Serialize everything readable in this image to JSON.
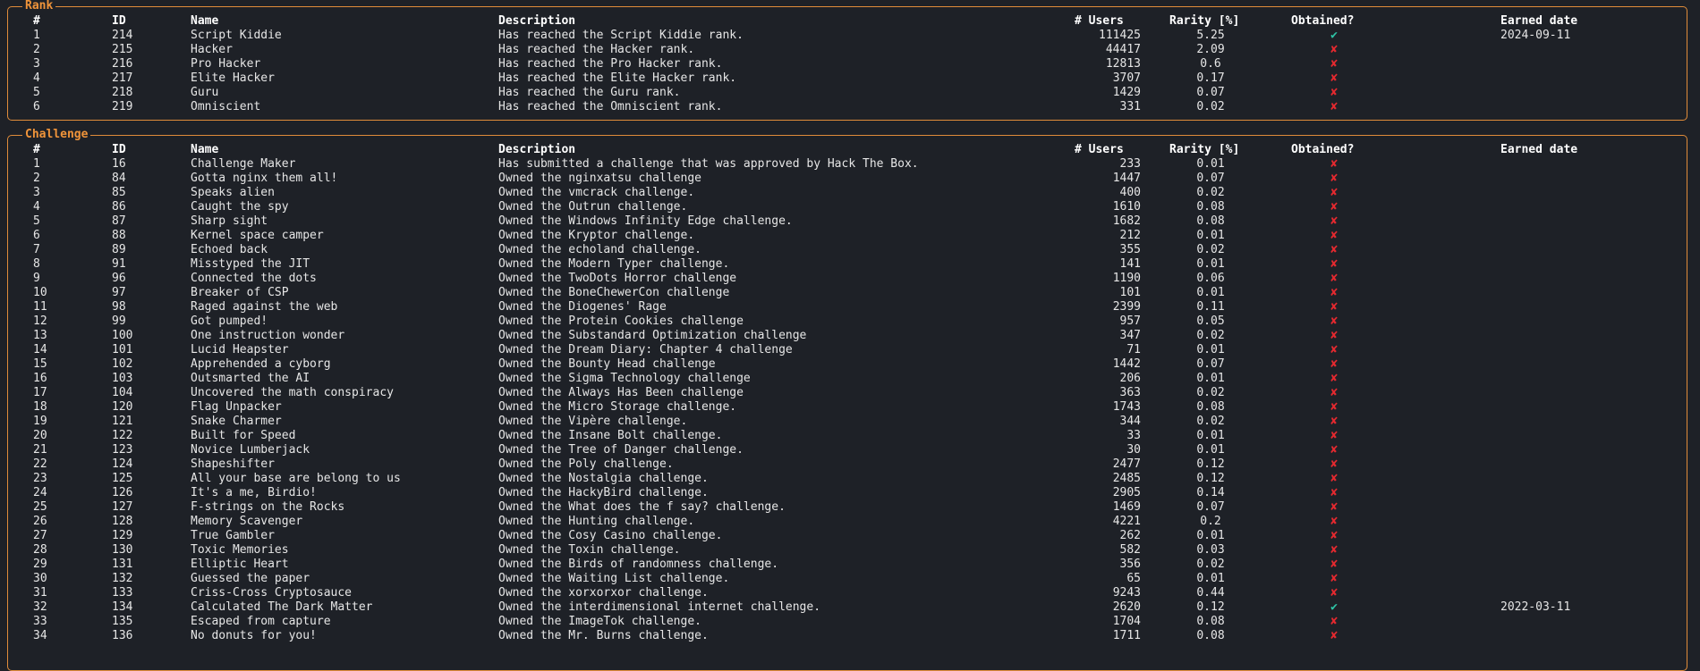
{
  "colors": {
    "border": "#e08c3a",
    "title": "#f0943a",
    "check": "#2ec4a6",
    "cross": "#e5292f",
    "background": "#1e2127"
  },
  "icons": {
    "obtained": "check-icon",
    "not_obtained": "cross-icon"
  },
  "headers": {
    "num": "#",
    "id": "ID",
    "name": "Name",
    "description": "Description",
    "users": "# Users",
    "rarity": "Rarity [%]",
    "obtained": "Obtained?",
    "earned": "Earned date"
  },
  "rank": {
    "title": "Rank",
    "rows": [
      {
        "num": "1",
        "id": "214",
        "name": "Script Kiddie",
        "description": "Has reached the Script Kiddie rank.",
        "users": "111425",
        "rarity": "5.25",
        "obtained": "✔",
        "earned": "2024-09-11"
      },
      {
        "num": "2",
        "id": "215",
        "name": "Hacker",
        "description": "Has reached the Hacker rank.",
        "users": "44417",
        "rarity": "2.09",
        "obtained": "✘",
        "earned": ""
      },
      {
        "num": "3",
        "id": "216",
        "name": "Pro Hacker",
        "description": "Has reached the Pro Hacker rank.",
        "users": "12813",
        "rarity": "0.6",
        "obtained": "✘",
        "earned": ""
      },
      {
        "num": "4",
        "id": "217",
        "name": "Elite Hacker",
        "description": "Has reached the Elite Hacker rank.",
        "users": "3707",
        "rarity": "0.17",
        "obtained": "✘",
        "earned": ""
      },
      {
        "num": "5",
        "id": "218",
        "name": "Guru",
        "description": "Has reached the Guru rank.",
        "users": "1429",
        "rarity": "0.07",
        "obtained": "✘",
        "earned": ""
      },
      {
        "num": "6",
        "id": "219",
        "name": "Omniscient",
        "description": "Has reached the Omniscient rank.",
        "users": "331",
        "rarity": "0.02",
        "obtained": "✘",
        "earned": ""
      }
    ]
  },
  "challenge": {
    "title": "Challenge",
    "rows": [
      {
        "num": "1",
        "id": "16",
        "name": "Challenge Maker",
        "description": "Has submitted a challenge that was approved by Hack The Box.",
        "users": "233",
        "rarity": "0.01",
        "obtained": "✘",
        "earned": ""
      },
      {
        "num": "2",
        "id": "84",
        "name": "Gotta nginx them all!",
        "description": "Owned the nginxatsu challenge",
        "users": "1447",
        "rarity": "0.07",
        "obtained": "✘",
        "earned": ""
      },
      {
        "num": "3",
        "id": "85",
        "name": "Speaks alien",
        "description": "Owned the vmcrack challenge.",
        "users": "400",
        "rarity": "0.02",
        "obtained": "✘",
        "earned": ""
      },
      {
        "num": "4",
        "id": "86",
        "name": "Caught the spy",
        "description": "Owned the Outrun challenge.",
        "users": "1610",
        "rarity": "0.08",
        "obtained": "✘",
        "earned": ""
      },
      {
        "num": "5",
        "id": "87",
        "name": "Sharp sight",
        "description": "Owned the Windows Infinity Edge challenge.",
        "users": "1682",
        "rarity": "0.08",
        "obtained": "✘",
        "earned": ""
      },
      {
        "num": "6",
        "id": "88",
        "name": "Kernel space camper",
        "description": "Owned the Kryptor challenge.",
        "users": "212",
        "rarity": "0.01",
        "obtained": "✘",
        "earned": ""
      },
      {
        "num": "7",
        "id": "89",
        "name": "Echoed back",
        "description": "Owned the echoland challenge.",
        "users": "355",
        "rarity": "0.02",
        "obtained": "✘",
        "earned": ""
      },
      {
        "num": "8",
        "id": "91",
        "name": "Misstyped the JIT",
        "description": "Owned the Modern Typer challenge.",
        "users": "141",
        "rarity": "0.01",
        "obtained": "✘",
        "earned": ""
      },
      {
        "num": "9",
        "id": "96",
        "name": "Connected the dots",
        "description": "Owned the TwoDots Horror challenge",
        "users": "1190",
        "rarity": "0.06",
        "obtained": "✘",
        "earned": ""
      },
      {
        "num": "10",
        "id": "97",
        "name": "Breaker of CSP",
        "description": "Owned the BoneChewerCon challenge",
        "users": "101",
        "rarity": "0.01",
        "obtained": "✘",
        "earned": ""
      },
      {
        "num": "11",
        "id": "98",
        "name": "Raged against the web",
        "description": "Owned the Diogenes' Rage",
        "users": "2399",
        "rarity": "0.11",
        "obtained": "✘",
        "earned": ""
      },
      {
        "num": "12",
        "id": "99",
        "name": "Got pumped!",
        "description": "Owned the Protein Cookies challenge",
        "users": "957",
        "rarity": "0.05",
        "obtained": "✘",
        "earned": ""
      },
      {
        "num": "13",
        "id": "100",
        "name": "One instruction wonder",
        "description": "Owned the Substandard Optimization challenge",
        "users": "347",
        "rarity": "0.02",
        "obtained": "✘",
        "earned": ""
      },
      {
        "num": "14",
        "id": "101",
        "name": "Lucid Heapster",
        "description": "Owned the Dream Diary: Chapter 4 challenge",
        "users": "71",
        "rarity": "0.01",
        "obtained": "✘",
        "earned": ""
      },
      {
        "num": "15",
        "id": "102",
        "name": "Apprehended a cyborg",
        "description": "Owned the Bounty Head challenge",
        "users": "1442",
        "rarity": "0.07",
        "obtained": "✘",
        "earned": ""
      },
      {
        "num": "16",
        "id": "103",
        "name": "Outsmarted the AI",
        "description": "Owned the Sigma Technology challenge",
        "users": "206",
        "rarity": "0.01",
        "obtained": "✘",
        "earned": ""
      },
      {
        "num": "17",
        "id": "104",
        "name": "Uncovered the math conspiracy",
        "description": "Owned the Always Has Been challenge",
        "users": "363",
        "rarity": "0.02",
        "obtained": "✘",
        "earned": ""
      },
      {
        "num": "18",
        "id": "120",
        "name": "Flag Unpacker",
        "description": "Owned the Micro Storage challenge.",
        "users": "1743",
        "rarity": "0.08",
        "obtained": "✘",
        "earned": ""
      },
      {
        "num": "19",
        "id": "121",
        "name": "Snake Charmer",
        "description": "Owned the Vipère challenge.",
        "users": "344",
        "rarity": "0.02",
        "obtained": "✘",
        "earned": ""
      },
      {
        "num": "20",
        "id": "122",
        "name": "Built for Speed",
        "description": "Owned the Insane Bolt challenge.",
        "users": "33",
        "rarity": "0.01",
        "obtained": "✘",
        "earned": ""
      },
      {
        "num": "21",
        "id": "123",
        "name": "Novice Lumberjack",
        "description": "Owned the Tree of Danger challenge.",
        "users": "30",
        "rarity": "0.01",
        "obtained": "✘",
        "earned": ""
      },
      {
        "num": "22",
        "id": "124",
        "name": "Shapeshifter",
        "description": "Owned the Poly challenge.",
        "users": "2477",
        "rarity": "0.12",
        "obtained": "✘",
        "earned": ""
      },
      {
        "num": "23",
        "id": "125",
        "name": "All your base are belong to us",
        "description": "Owned the Nostalgia challenge.",
        "users": "2485",
        "rarity": "0.12",
        "obtained": "✘",
        "earned": ""
      },
      {
        "num": "24",
        "id": "126",
        "name": "It's a me, Birdio!",
        "description": "Owned the HackyBird challenge.",
        "users": "2905",
        "rarity": "0.14",
        "obtained": "✘",
        "earned": ""
      },
      {
        "num": "25",
        "id": "127",
        "name": "F-strings on the Rocks",
        "description": "Owned the What does the f say? challenge.",
        "users": "1469",
        "rarity": "0.07",
        "obtained": "✘",
        "earned": ""
      },
      {
        "num": "26",
        "id": "128",
        "name": "Memory Scavenger",
        "description": "Owned the Hunting challenge.",
        "users": "4221",
        "rarity": "0.2",
        "obtained": "✘",
        "earned": ""
      },
      {
        "num": "27",
        "id": "129",
        "name": "True Gambler",
        "description": "Owned the Cosy Casino challenge.",
        "users": "262",
        "rarity": "0.01",
        "obtained": "✘",
        "earned": ""
      },
      {
        "num": "28",
        "id": "130",
        "name": "Toxic Memories",
        "description": "Owned the Toxin challenge.",
        "users": "582",
        "rarity": "0.03",
        "obtained": "✘",
        "earned": ""
      },
      {
        "num": "29",
        "id": "131",
        "name": "Elliptic Heart",
        "description": "Owned the Birds of randomness challenge.",
        "users": "356",
        "rarity": "0.02",
        "obtained": "✘",
        "earned": ""
      },
      {
        "num": "30",
        "id": "132",
        "name": "Guessed the paper",
        "description": "Owned the Waiting List challenge.",
        "users": "65",
        "rarity": "0.01",
        "obtained": "✘",
        "earned": ""
      },
      {
        "num": "31",
        "id": "133",
        "name": "Criss-Cross Cryptosauce",
        "description": "Owned the xorxorxor challenge.",
        "users": "9243",
        "rarity": "0.44",
        "obtained": "✘",
        "earned": ""
      },
      {
        "num": "32",
        "id": "134",
        "name": "Calculated The Dark Matter",
        "description": "Owned the interdimensional internet challenge.",
        "users": "2620",
        "rarity": "0.12",
        "obtained": "✔",
        "earned": "2022-03-11"
      },
      {
        "num": "33",
        "id": "135",
        "name": "Escaped from capture",
        "description": "Owned the ImageTok challenge.",
        "users": "1704",
        "rarity": "0.08",
        "obtained": "✘",
        "earned": ""
      },
      {
        "num": "34",
        "id": "136",
        "name": "No donuts for you!",
        "description": "Owned the Mr. Burns challenge.",
        "users": "1711",
        "rarity": "0.08",
        "obtained": "✘",
        "earned": ""
      }
    ]
  }
}
